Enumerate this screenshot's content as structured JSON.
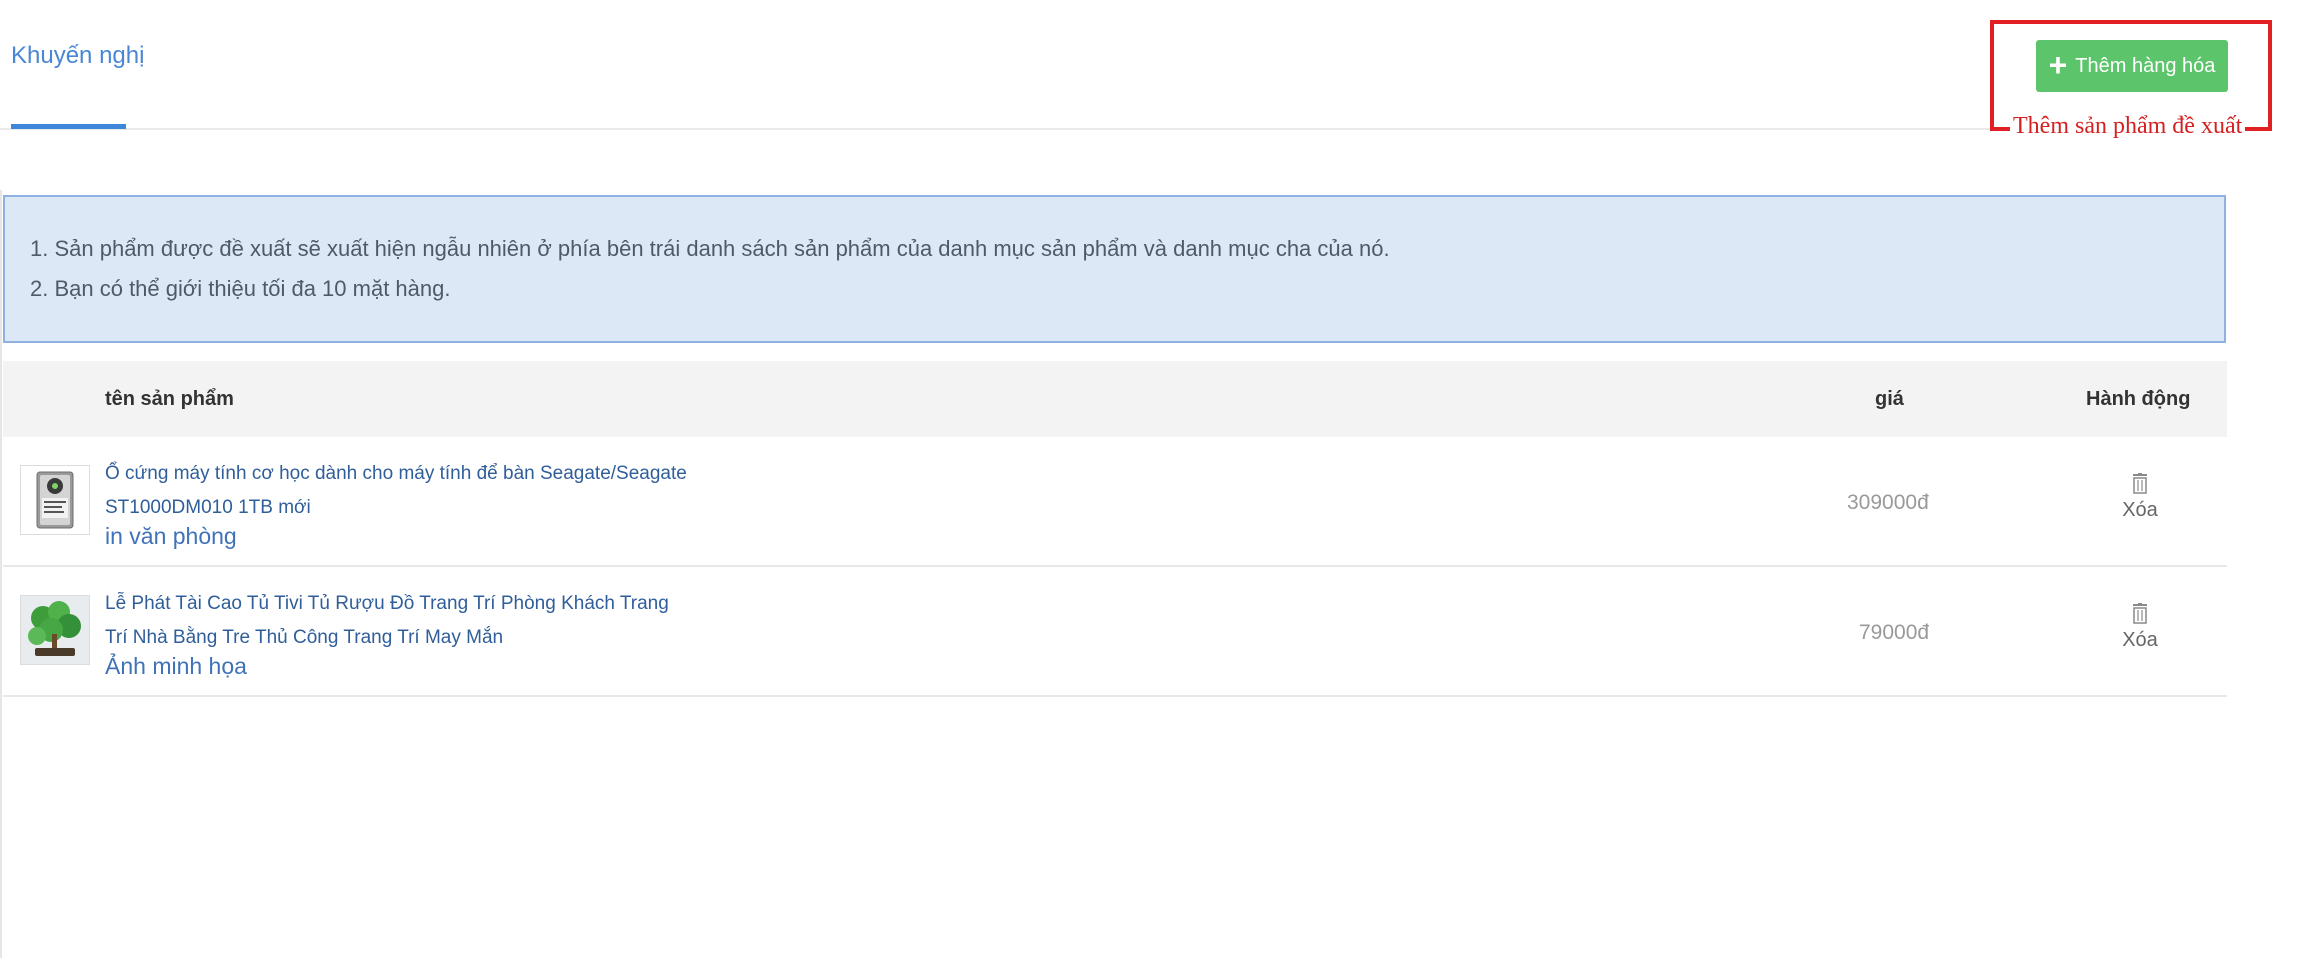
{
  "tabs": {
    "active": "Khuyến nghị"
  },
  "toolbar": {
    "add_label": "Thêm hàng hóa",
    "annotation": "Thêm sản phẩm đề xuất"
  },
  "notice": {
    "lines": [
      "1. Sản phẩm được đề xuất sẽ xuất hiện ngẫu nhiên ở phía bên trái danh sách sản phẩm của danh mục sản phẩm và danh mục cha của nó.",
      "2. Bạn có thể giới thiệu tối đa 10 mặt hàng."
    ]
  },
  "table": {
    "headers": {
      "name": "tên sản phẩm",
      "price": "giá",
      "action": "Hành động"
    },
    "rows": [
      {
        "name_line1": "Ổ cứng máy tính cơ học dành cho máy tính để bàn Seagate/Seagate",
        "name_line2": "ST1000DM010 1TB mới",
        "subtitle": "in văn phòng",
        "price": "309000đ",
        "action": "Xóa",
        "thumb_icon": "hard-drive-thumbnail"
      },
      {
        "name_line1": "Lễ Phát Tài Cao Tủ Tivi Tủ Rượu Đồ Trang Trí Phòng Khách Trang",
        "name_line2": "Trí Nhà Bằng Tre Thủ Công Trang Trí May Mắn",
        "subtitle": "Ảnh minh họa",
        "price": "79000đ",
        "action": "Xóa",
        "thumb_icon": "plant-decor-thumbnail"
      }
    ]
  },
  "colors": {
    "accent": "#3d86d9",
    "button_green": "#5cc46a",
    "annotation_red": "#d42020",
    "notice_bg": "#dde8f7"
  }
}
